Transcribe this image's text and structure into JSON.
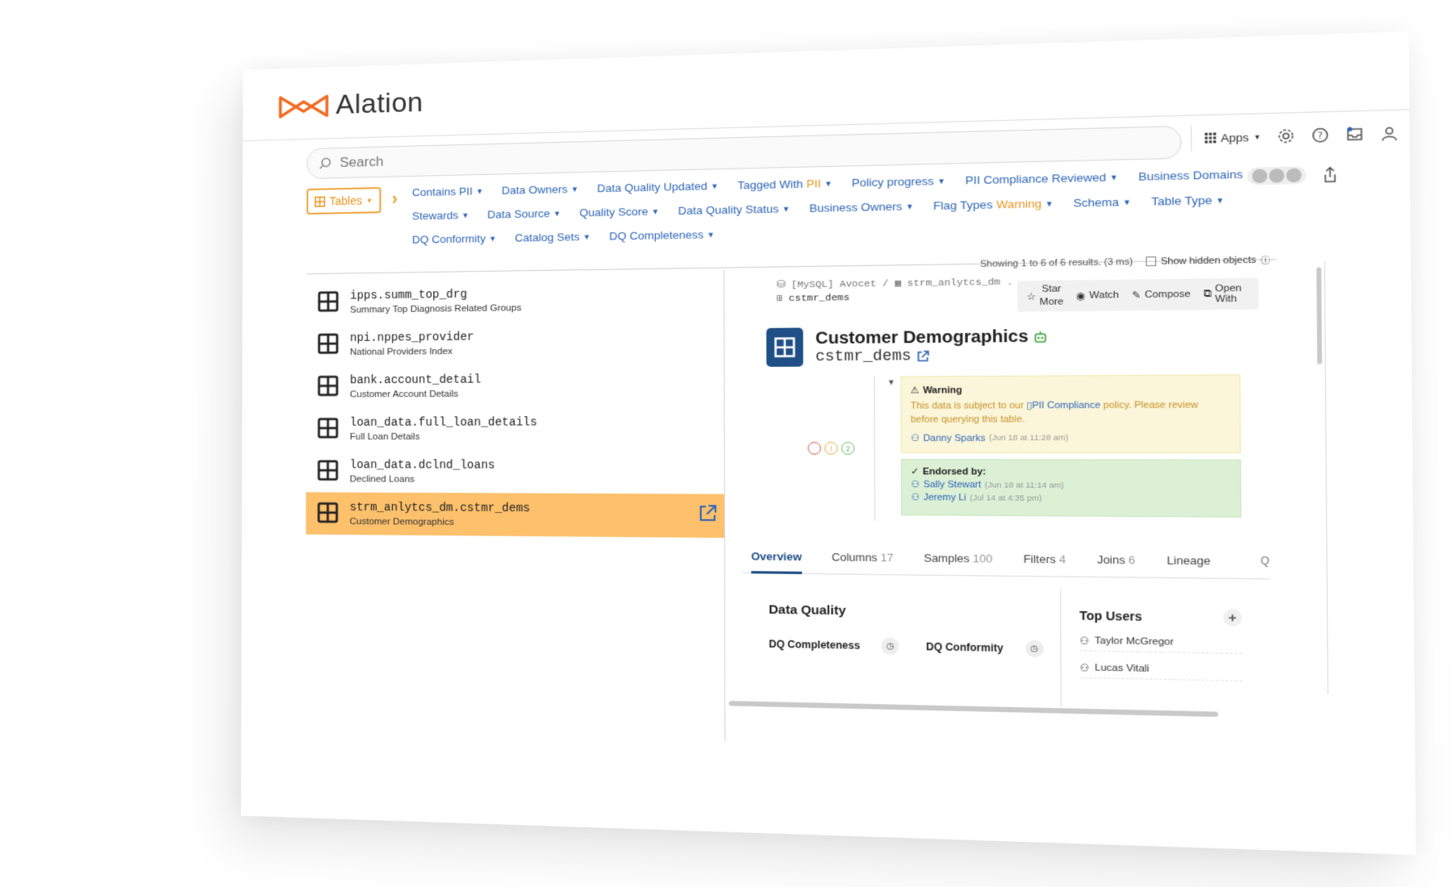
{
  "app": {
    "brand": "Alation",
    "brand_color": "#f26a21",
    "accent": "#2e66b8"
  },
  "search": {
    "placeholder": "Search"
  },
  "header": {
    "apps_label": "Apps",
    "icons": [
      "settings-icon",
      "help-icon",
      "inbox-icon",
      "user-icon"
    ]
  },
  "object_type": {
    "label": "Tables"
  },
  "filters": [
    {
      "label": "Contains PII",
      "highlight": ""
    },
    {
      "label": "Data Owners",
      "highlight": ""
    },
    {
      "label": "Data Quality Updated",
      "highlight": ""
    },
    {
      "label": "Tagged With ",
      "highlight": "PII"
    },
    {
      "label": "Policy progress",
      "highlight": ""
    },
    {
      "label": "PII Compliance Reviewed",
      "highlight": ""
    },
    {
      "label": "Business Domains",
      "highlight": ""
    },
    {
      "label": "Stewards",
      "highlight": ""
    },
    {
      "label": "Data Source",
      "highlight": ""
    },
    {
      "label": "Quality Score",
      "highlight": ""
    },
    {
      "label": "Data Quality Status",
      "highlight": ""
    },
    {
      "label": "Business Owners",
      "highlight": ""
    },
    {
      "label": "Flag Types ",
      "highlight": "Warning"
    },
    {
      "label": "Schema",
      "highlight": ""
    },
    {
      "label": "Table Type",
      "highlight": ""
    },
    {
      "label": "DQ Conformity",
      "highlight": ""
    },
    {
      "label": "Catalog Sets",
      "highlight": ""
    },
    {
      "label": "DQ Completeness",
      "highlight": ""
    }
  ],
  "results": {
    "summary": "Showing 1 to 6 of 6 results. (3 ms)",
    "hidden_label": "Show hidden objects"
  },
  "list": [
    {
      "name": "ipps.summ_top_drg",
      "title": "Summary Top Diagnosis Related Groups"
    },
    {
      "name": "npi.nppes_provider",
      "title": "National Providers Index"
    },
    {
      "name": "bank.account_detail",
      "title": "Customer Account Details"
    },
    {
      "name": "loan_data.full_loan_details",
      "title": "Full Loan Details"
    },
    {
      "name": "loan_data.dclnd_loans",
      "title": "Declined Loans"
    },
    {
      "name": "strm_anlytcs_dm.cstmr_dems",
      "title": "Customer Demographics"
    }
  ],
  "detail": {
    "breadcrumb": {
      "source": "[MySQL] Avocet",
      "sep": "/",
      "schema": "strm_anlytcs_dm .",
      "table": "cstmr_dems"
    },
    "actions": {
      "star": "Star",
      "more": "More",
      "watch": "Watch",
      "compose": "Compose",
      "open_with": "Open With"
    },
    "title": "Customer Demographics",
    "subtitle": "cstmr_dems",
    "flag_counts": {
      "red": "",
      "yellow": "!",
      "green": "2"
    },
    "warning": {
      "heading": "Warning",
      "text_before": "This data is subject to our ",
      "link": "PII Compliance",
      "text_after": " policy.  Please review before querying this table.",
      "author": "Danny Sparks",
      "time": "(Jun 18 at 11:28 am)"
    },
    "endorsed": {
      "heading": "Endorsed by:",
      "users": [
        {
          "name": "Sally Stewart",
          "time": "(Jun 18 at 11:14 am)"
        },
        {
          "name": "Jeremy Li",
          "time": "(Jul 14 at 4:35 pm)"
        }
      ]
    },
    "tabs": [
      {
        "label": "Overview",
        "count": ""
      },
      {
        "label": "Columns",
        "count": "17"
      },
      {
        "label": "Samples",
        "count": "100"
      },
      {
        "label": "Filters",
        "count": "4"
      },
      {
        "label": "Joins",
        "count": "6"
      },
      {
        "label": "Lineage",
        "count": ""
      }
    ],
    "data_quality": {
      "title": "Data Quality",
      "completeness": "DQ Completeness",
      "conformity": "DQ Conformity"
    },
    "top_users": {
      "title": "Top Users",
      "users": [
        "Taylor McGregor",
        "Lucas Vitali"
      ]
    }
  }
}
